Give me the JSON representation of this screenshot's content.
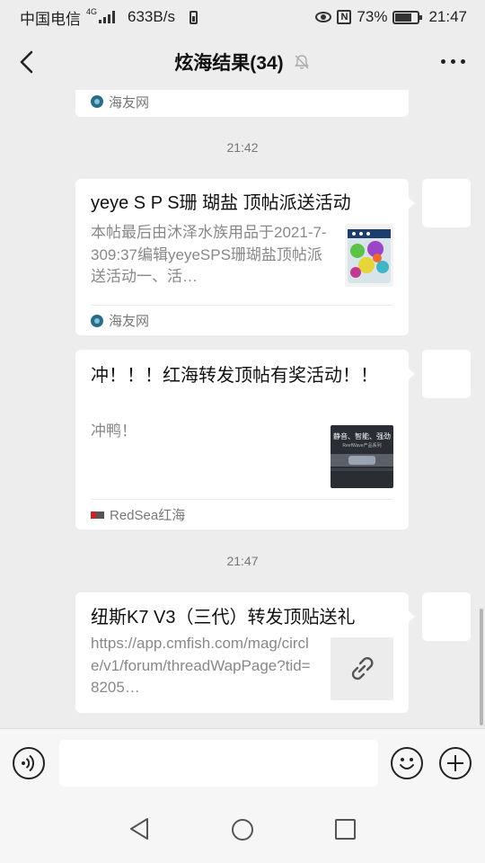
{
  "status_bar": {
    "carrier": "中国电信",
    "network": "4G",
    "speed": "633B/s",
    "battery": "73%",
    "battery_level": 0.73,
    "time": "21:47"
  },
  "header": {
    "title": "炫海结果(34)",
    "icons": [
      "back-arrow-icon",
      "mute-bell-icon",
      "more-icon"
    ]
  },
  "messages": [
    {
      "type": "card-footer-only",
      "source": "海友网"
    },
    {
      "type": "time",
      "text": "21:42"
    },
    {
      "type": "card",
      "title": "yeye S P S珊 瑚盐 顶帖派送活动",
      "desc": "本帖最后由沐泽水族用品于2021-7-309:37编辑yeyeSPS珊瑚盐顶帖派送活动一、活…",
      "source": "海友网",
      "thumb": "coral-salt-bucket-image"
    },
    {
      "type": "card",
      "title": "冲！！！红海转发顶帖有奖活动！！",
      "desc": "冲鸭！",
      "source": "RedSea红海",
      "thumb_text": "静音、智能、强劲",
      "thumb_subtext": "ReefWave产品系列"
    },
    {
      "type": "time",
      "text": "21:47"
    },
    {
      "type": "card",
      "title": "纽斯K7 V3（三代）转发顶贴送礼",
      "desc": "https://app.cmfish.com/mag/circle/v1/forum/threadWapPage?tid=8205…",
      "thumb": "link-icon"
    }
  ],
  "input_bar": {
    "placeholder": "",
    "icons": [
      "voice-icon",
      "emoji-icon",
      "plus-icon"
    ]
  },
  "nav_bar": {
    "icons": [
      "nav-back-icon",
      "nav-home-icon",
      "nav-recent-icon"
    ]
  },
  "colors": {
    "background": "#ededed",
    "card": "#ffffff",
    "text": "#111111",
    "muted": "#888888",
    "source_icon": "#2a6b8a",
    "redsea": "#c0262d"
  }
}
